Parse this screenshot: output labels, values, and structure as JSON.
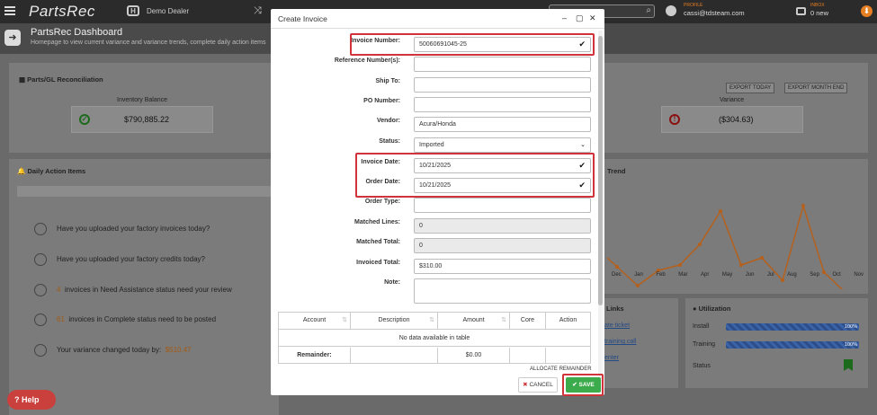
{
  "app": {
    "name": "PartsRec",
    "dealer": "Demo Dealer",
    "profile_label": "PROFILE",
    "profile_email": "cassi@tdsteam.com",
    "inbox_label": "INBOX",
    "inbox_value": "0 new"
  },
  "page": {
    "title": "PartsRec Dashboard",
    "subtitle": "Homepage to view current variance and variance trends, complete daily action items"
  },
  "recon": {
    "title": "Parts/GL Reconciliation",
    "inventory_label": "Inventory Balance",
    "inventory_value": "$790,885.22",
    "variance_label": "Variance",
    "variance_value": "($304.63)",
    "export_today": "EXPORT TODAY",
    "export_month": "EXPORT MONTH END"
  },
  "daily": {
    "title": "Daily Action Items",
    "items": [
      {
        "num": "",
        "text": "Have you uploaded your factory invoices today?",
        "extra": ""
      },
      {
        "num": "",
        "text": "Have you uploaded your factory credits today?",
        "extra": ""
      },
      {
        "num": "4",
        "text": "invoices in Need Assistance status need your review",
        "extra": ""
      },
      {
        "num": "61",
        "text": "invoices in Complete status need to be posted",
        "extra": ""
      },
      {
        "num": "",
        "text": "Your variance changed today by:",
        "extra": "$510.47"
      }
    ]
  },
  "trend": {
    "title": "Trend",
    "months": [
      "Dec",
      "Jan",
      "Feb",
      "Mar",
      "Apr",
      "May",
      "Jun",
      "Jul",
      "Aug",
      "Sep",
      "Oct",
      "Nov"
    ]
  },
  "links": {
    "title": "Links",
    "items": [
      "ate ticket",
      "training call",
      "enter"
    ]
  },
  "utilization": {
    "title": "Utilization",
    "install_label": "Install",
    "install_pct": "100%",
    "training_label": "Training",
    "training_pct": "100%",
    "status_label": "Status"
  },
  "modal": {
    "title": "Create Invoice",
    "fields": [
      {
        "label": "Invoice Number:",
        "value": "50060691045-25",
        "check": "✔",
        "type": "text"
      },
      {
        "label": "Reference Number(s):",
        "value": "",
        "check": "",
        "type": "text"
      },
      {
        "label": "Ship To:",
        "value": "",
        "check": "",
        "type": "text"
      },
      {
        "label": "PO Number:",
        "value": "",
        "check": "",
        "type": "text"
      },
      {
        "label": "Vendor:",
        "value": "Acura/Honda",
        "check": "",
        "type": "text"
      },
      {
        "label": "Status:",
        "value": "Imported",
        "check": "",
        "type": "select"
      },
      {
        "label": "Invoice Date:",
        "value": "10/21/2025",
        "check": "✔",
        "type": "text"
      },
      {
        "label": "Order Date:",
        "value": "10/21/2025",
        "check": "✔",
        "type": "text"
      },
      {
        "label": "Order Type:",
        "value": "",
        "check": "",
        "type": "text"
      },
      {
        "label": "Matched Lines:",
        "value": "0",
        "check": "",
        "type": "readonly"
      },
      {
        "label": "Matched Total:",
        "value": "0",
        "check": "",
        "type": "readonly"
      },
      {
        "label": "Invoiced Total:",
        "value": "$310.00",
        "check": "",
        "type": "text"
      },
      {
        "label": "Note:",
        "value": "",
        "check": "",
        "type": "textarea"
      }
    ],
    "table": {
      "headers": [
        "Account",
        "Description",
        "Amount",
        "Core",
        "Action"
      ],
      "empty": "No data available in table",
      "remainder_label": "Remainder:",
      "remainder_value": "$0.00"
    },
    "allocate": "ALLOCATE REMAINDER",
    "cancel": "CANCEL",
    "save": "SAVE"
  },
  "help": "Help",
  "colors": {
    "highlight": "#d0343a",
    "save": "#3cab4b",
    "accent": "#e67e22"
  }
}
